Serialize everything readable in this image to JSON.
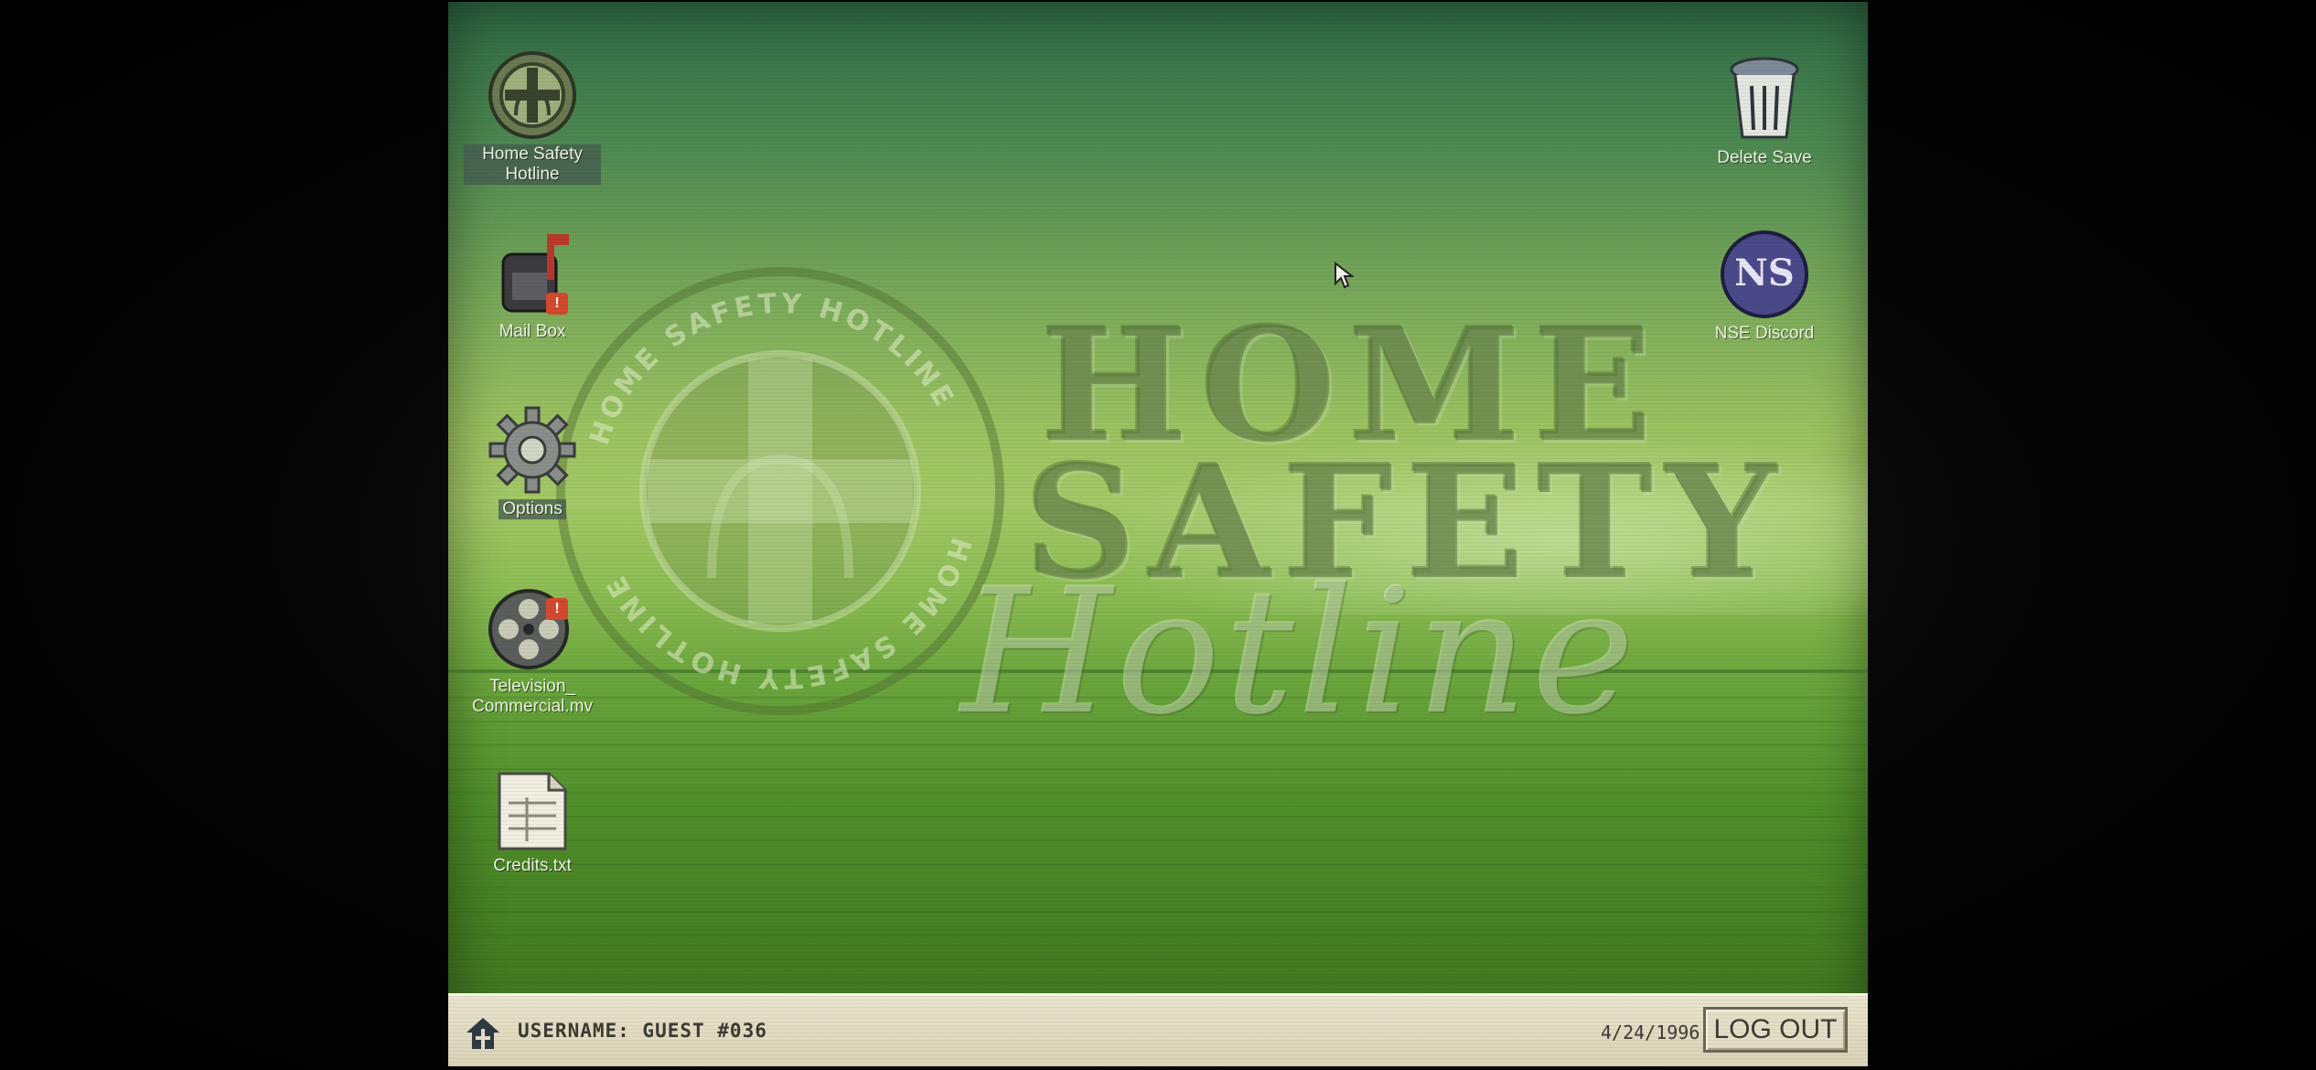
{
  "desktop": {
    "wallpaper": {
      "seal_text": "HOME SAFETY HOTLINE",
      "title_line1": "HOME",
      "title_line2": "SAFETY",
      "title_line3": "Hotline"
    },
    "left_icons": [
      {
        "label": "Home Safety Hotline",
        "icon": "home-safety-hotline-icon"
      },
      {
        "label": "Mail Box",
        "icon": "mailbox-icon",
        "badge": "!"
      },
      {
        "label": "Options",
        "icon": "gear-icon"
      },
      {
        "label": "Television_ Commercial.mv",
        "icon": "film-reel-icon",
        "badge": "!"
      },
      {
        "label": "Credits.txt",
        "icon": "text-file-icon"
      }
    ],
    "right_icons": [
      {
        "label": "Delete Save",
        "icon": "trash-can-icon"
      },
      {
        "label": "NSE Discord",
        "icon": "nse-discord-icon",
        "text": "NS"
      }
    ]
  },
  "taskbar": {
    "username": "USERNAME: GUEST #036",
    "date": "4/24/1996",
    "logout_label": "LOG OUT"
  },
  "colors": {
    "taskbar_bg": "#e3dec6",
    "badge": "#d24a2e",
    "label_text": "#eef3e2"
  }
}
